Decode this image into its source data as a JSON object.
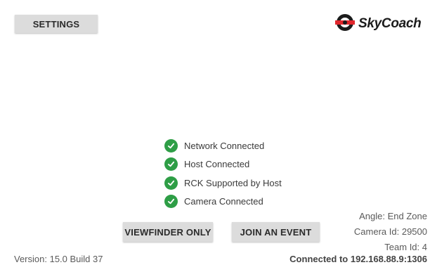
{
  "header": {
    "settings_label": "SETTINGS",
    "logo_text": "SkyCoach"
  },
  "status": [
    {
      "label": "Network Connected",
      "icon": "check-circle-icon"
    },
    {
      "label": "Host Connected",
      "icon": "check-circle-icon"
    },
    {
      "label": "RCK Supported by Host",
      "icon": "check-circle-icon"
    },
    {
      "label": "Camera Connected",
      "icon": "check-circle-icon"
    }
  ],
  "actions": {
    "viewfinder_label": "VIEWFINDER ONLY",
    "join_label": "JOIN AN EVENT"
  },
  "info": {
    "angle": "Angle: End Zone",
    "camera_id": "Camera Id: 29500",
    "team_id": "Team Id: 4"
  },
  "footer": {
    "version": "Version: 15.0 Build 37",
    "connected": "Connected to 192.168.88.9:1306"
  },
  "colors": {
    "button_bg": "#dcdcdc",
    "check_green": "#2e9e46",
    "logo_red": "#e0262c"
  }
}
